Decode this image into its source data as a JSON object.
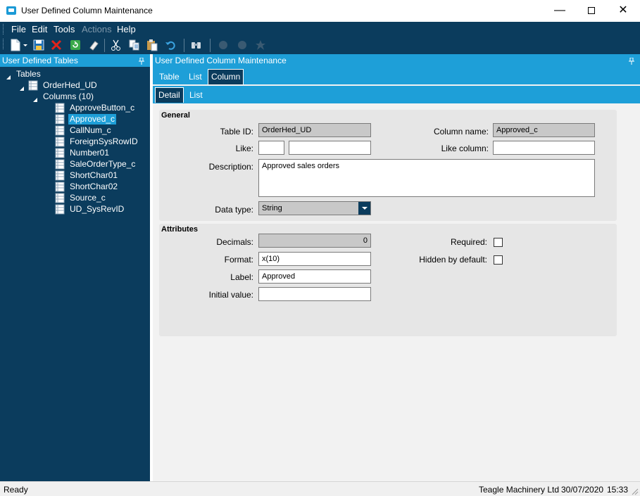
{
  "window": {
    "title": "User Defined Column Maintenance",
    "minimize_label": "—",
    "close_label": "✕"
  },
  "menu": {
    "file": "File",
    "edit": "Edit",
    "tools": "Tools",
    "actions": "Actions",
    "help": "Help"
  },
  "toolbar": {
    "icons": [
      "new-icon",
      "save-icon",
      "delete-icon",
      "refresh-icon",
      "clear-icon",
      "cut-icon",
      "copy-icon",
      "paste-icon",
      "undo-icon",
      "search-icon",
      "attachment-icon",
      "lock-icon",
      "delete-row-icon"
    ]
  },
  "left_panel": {
    "title": "User Defined Tables",
    "tree": {
      "root": "Tables",
      "table": "OrderHed_UD",
      "columns_node": "Columns (10)",
      "columns": [
        "ApproveButton_c",
        "Approved_c",
        "CallNum_c",
        "ForeignSysRowID",
        "Number01",
        "SaleOrderType_c",
        "ShortChar01",
        "ShortChar02",
        "Source_c",
        "UD_SysRevID"
      ],
      "selected_index": 1
    }
  },
  "right_panel": {
    "title": "User Defined Column Maintenance",
    "tabs": [
      "Table",
      "List",
      "Column"
    ],
    "active_tab": "Column",
    "subtabs": [
      "Detail",
      "List"
    ],
    "active_subtab": "Detail",
    "general": {
      "title": "General",
      "table_id_label": "Table ID:",
      "table_id_value": "OrderHed_UD",
      "column_name_label": "Column name:",
      "column_name_value": "Approved_c",
      "like_label": "Like:",
      "like_value": "",
      "like2_value": "",
      "like_column_label": "Like column:",
      "like_column_value": "",
      "description_label": "Description:",
      "description_value": "Approved sales orders",
      "data_type_label": "Data type:",
      "data_type_value": "String"
    },
    "attributes": {
      "title": "Attributes",
      "decimals_label": "Decimals:",
      "decimals_value": "0",
      "required_label": "Required:",
      "required_checked": false,
      "format_label": "Format:",
      "format_value": "x(10)",
      "hidden_label": "Hidden by default:",
      "hidden_checked": false,
      "label_label": "Label:",
      "label_value": "Approved",
      "initial_label": "Initial value:",
      "initial_value": ""
    }
  },
  "status": {
    "state": "Ready",
    "company": "Teagle Machinery Ltd",
    "date": "30/07/2020",
    "time": "15:33"
  },
  "colors": {
    "dark_navy": "#0b3c5d",
    "accent_blue": "#1e9fd8",
    "form_bg": "#f2f2f2",
    "group_bg": "#e6e6e6"
  }
}
